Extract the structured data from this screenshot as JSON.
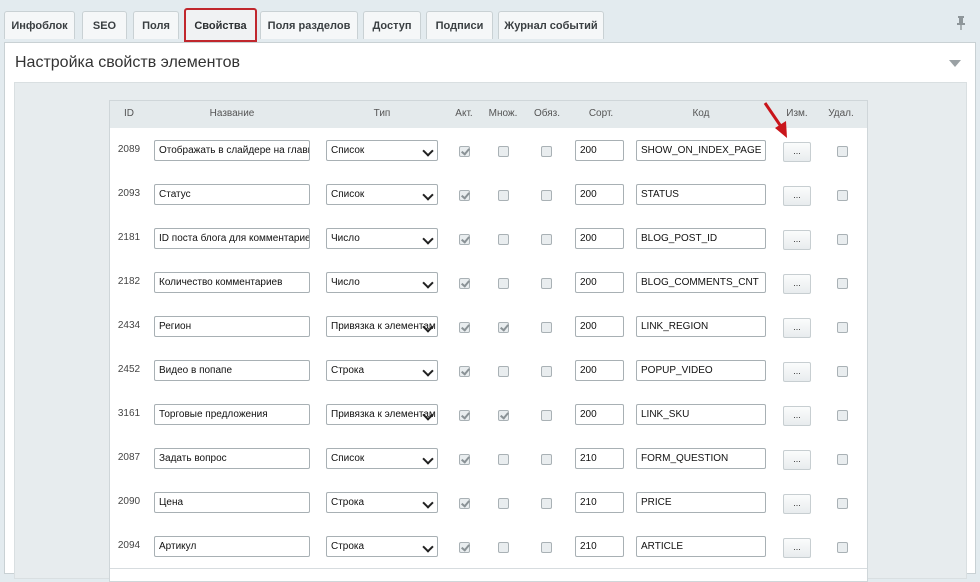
{
  "tabs": [
    "Инфоблок",
    "SEO",
    "Поля",
    "Свойства",
    "Поля разделов",
    "Доступ",
    "Подписи",
    "Журнал событий"
  ],
  "active_tab": "Свойства",
  "panel": {
    "title": "Настройка свойств элементов"
  },
  "columns": {
    "id": "ID",
    "name": "Название",
    "type": "Тип",
    "active": "Акт.",
    "multiple": "Множ.",
    "required": "Обяз.",
    "sort": "Сорт.",
    "code": "Код",
    "edit": "Изм.",
    "delete": "Удал."
  },
  "rows": [
    {
      "id": "2089",
      "name": "Отображать в слайдере на главной",
      "type": "Список",
      "active": true,
      "multiple": false,
      "required": false,
      "sort": "200",
      "code": "SHOW_ON_INDEX_PAGE",
      "edit": "..."
    },
    {
      "id": "2093",
      "name": "Статус",
      "type": "Список",
      "active": true,
      "multiple": false,
      "required": false,
      "sort": "200",
      "code": "STATUS",
      "edit": "..."
    },
    {
      "id": "2181",
      "name": "ID поста блога для комментариев",
      "type": "Число",
      "active": true,
      "multiple": false,
      "required": false,
      "sort": "200",
      "code": "BLOG_POST_ID",
      "edit": "..."
    },
    {
      "id": "2182",
      "name": "Количество комментариев",
      "type": "Число",
      "active": true,
      "multiple": false,
      "required": false,
      "sort": "200",
      "code": "BLOG_COMMENTS_CNT",
      "edit": "..."
    },
    {
      "id": "2434",
      "name": "Регион",
      "type": "Привязка к элементам",
      "active": true,
      "multiple": true,
      "required": false,
      "sort": "200",
      "code": "LINK_REGION",
      "edit": "..."
    },
    {
      "id": "2452",
      "name": "Видео в попапе",
      "type": "Строка",
      "active": true,
      "multiple": false,
      "required": false,
      "sort": "200",
      "code": "POPUP_VIDEO",
      "edit": "..."
    },
    {
      "id": "3161",
      "name": "Торговые предложения",
      "type": "Привязка к элементам",
      "active": true,
      "multiple": true,
      "required": false,
      "sort": "200",
      "code": "LINK_SKU",
      "edit": "..."
    },
    {
      "id": "2087",
      "name": "Задать вопрос",
      "type": "Список",
      "active": true,
      "multiple": false,
      "required": false,
      "sort": "210",
      "code": "FORM_QUESTION",
      "edit": "..."
    },
    {
      "id": "2090",
      "name": "Цена",
      "type": "Строка",
      "active": true,
      "multiple": false,
      "required": false,
      "sort": "210",
      "code": "PRICE",
      "edit": "..."
    },
    {
      "id": "2094",
      "name": "Артикул",
      "type": "Строка",
      "active": true,
      "multiple": false,
      "required": false,
      "sort": "210",
      "code": "ARTICLE",
      "edit": "..."
    }
  ],
  "colors": {
    "accent_red": "#c0272d",
    "arrow_red": "#c9151b"
  },
  "icons": {
    "pin": "pin-icon",
    "collapse": "triangle-down-icon",
    "annotation": "red-arrow"
  }
}
